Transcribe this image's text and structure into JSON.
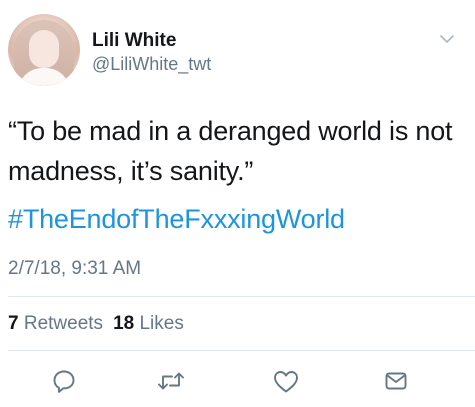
{
  "user": {
    "name": "Lili White",
    "handle": "@LiliWhite_twt"
  },
  "tweet": {
    "text": "“To be mad in a deranged world is not madness, it’s sanity.”",
    "hashtag": "#TheEndofTheFxxxingWorld",
    "timestamp": "2/7/18, 9:31 AM"
  },
  "stats": {
    "retweets_count": "7",
    "retweets_label": "Retweets",
    "likes_count": "18",
    "likes_label": "Likes"
  },
  "icons": {
    "reply": "reply-icon",
    "retweet": "retweet-icon",
    "like": "heart-icon",
    "dm": "envelope-icon",
    "menu": "chevron-down-icon"
  },
  "colors": {
    "link": "#1b95e0",
    "secondary_text": "#657786",
    "divider": "#e1e8ed",
    "icon": "#657786"
  }
}
